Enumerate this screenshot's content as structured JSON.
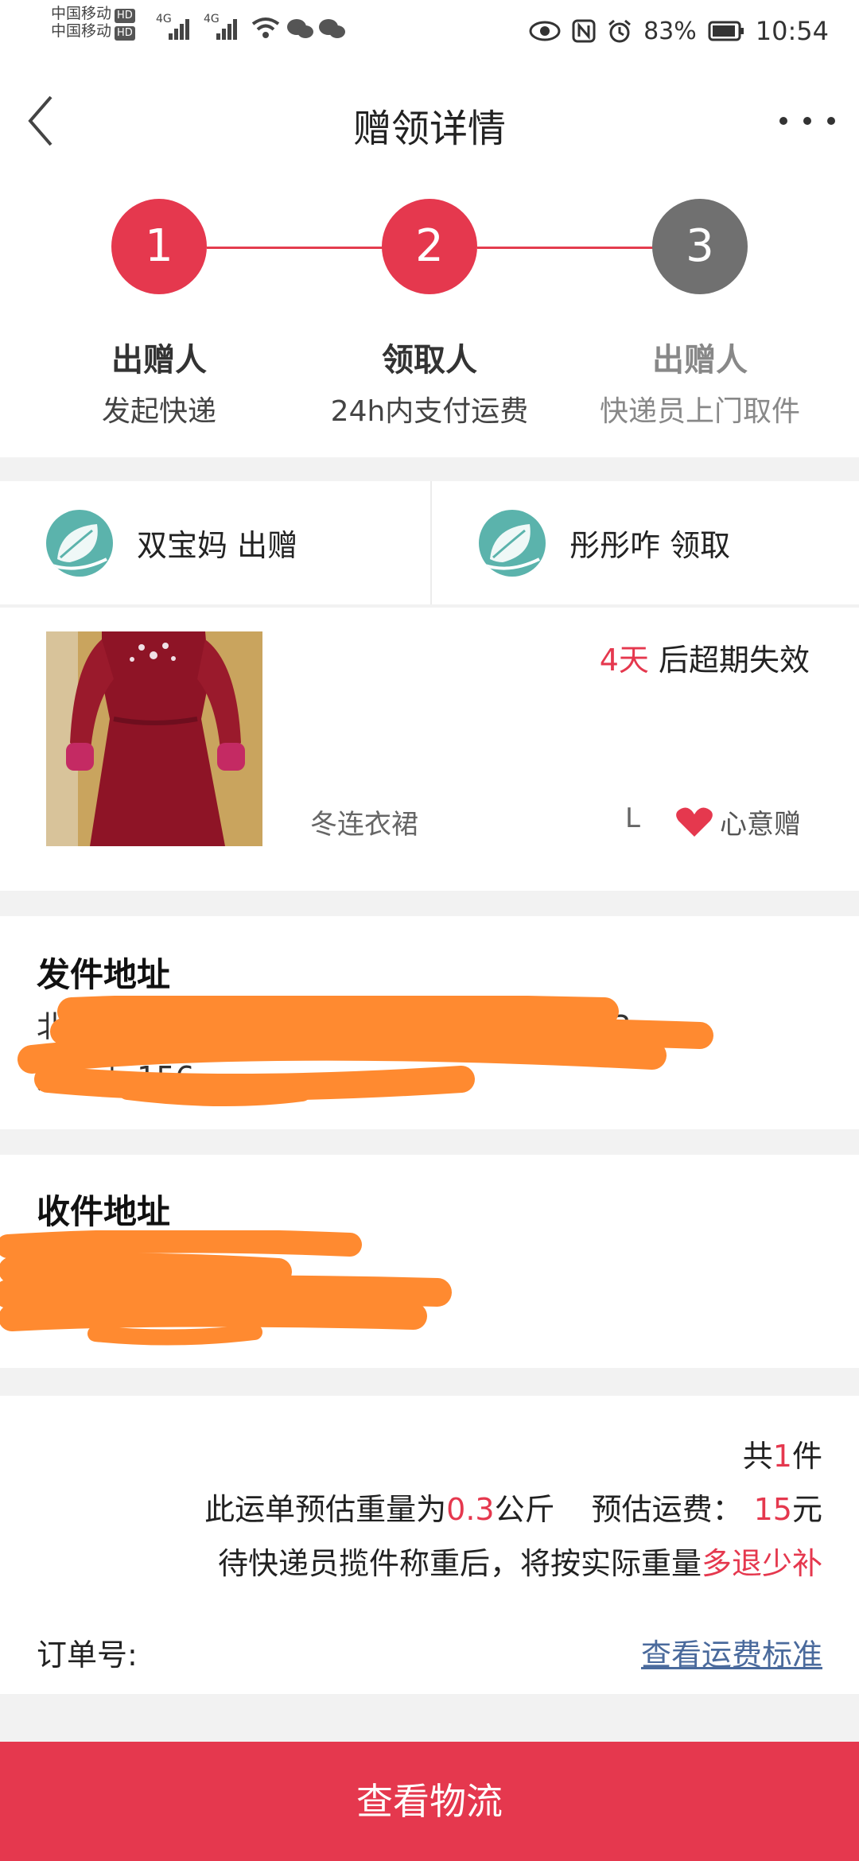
{
  "status_bar": {
    "carrier_1": "中国移动",
    "carrier_2": "中国移动",
    "hd": "HD",
    "net_1": "4G",
    "net_2": "4G",
    "battery": "83%",
    "time": "10:54"
  },
  "header": {
    "title": "赠领详情"
  },
  "steps": [
    {
      "number": "1",
      "title": "出赠人",
      "subtitle": "发起快递",
      "state": "done"
    },
    {
      "number": "2",
      "title": "领取人",
      "subtitle": "24h内支付运费",
      "state": "done"
    },
    {
      "number": "3",
      "title": "出赠人",
      "subtitle": "快递员上门取件",
      "state": "pending"
    }
  ],
  "parties": {
    "giver": "双宝妈 出赠",
    "receiver": "彤彤咋 领取"
  },
  "item": {
    "expire_days": "4天",
    "expire_text": " 后超期失效",
    "name": "冬连衣裙",
    "size": "L",
    "gift_type": "心意赠"
  },
  "sender_address": {
    "title": "发件地址",
    "line1_start": "北",
    "line1_end": "单元403",
    "line2_start": "刘女士 156"
  },
  "receiver_address": {
    "title": "收件地址"
  },
  "summary": {
    "count_pre": "共",
    "count": "1",
    "count_post": "件",
    "weight_pre": "此运单预估重量为",
    "weight": "0.3",
    "weight_unit": "公斤",
    "fee_label": "预估运费：",
    "fee": "15",
    "fee_unit": "元",
    "note_pre": "待快递员揽件称重后，将按实际重量",
    "note_red": "多退少补",
    "order_label": "订单号:",
    "fee_standard_link": "查看运费标准"
  },
  "bottom_button": "查看物流",
  "colors": {
    "accent": "#e5384e",
    "pending": "#707070",
    "link": "#4a6a9c",
    "redaction": "#ff8a30"
  }
}
